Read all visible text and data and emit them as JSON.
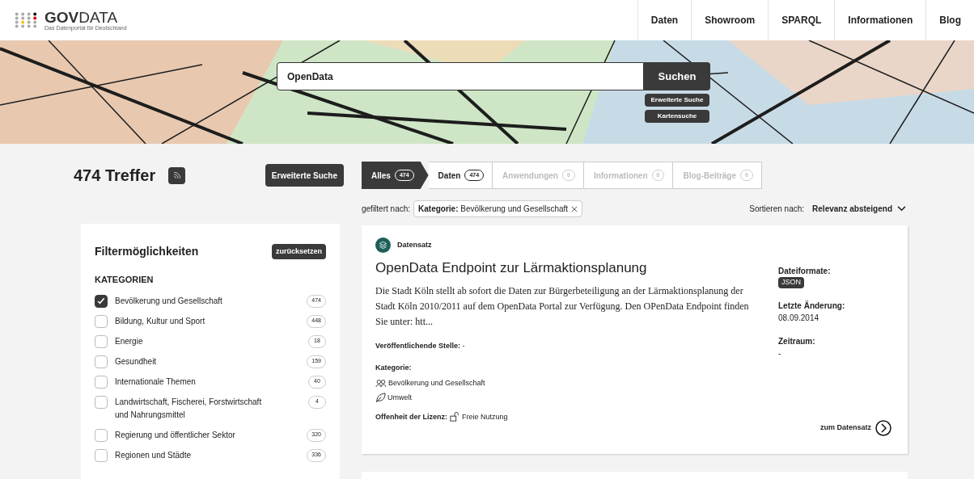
{
  "header": {
    "logo_bold": "GOV",
    "logo_rest": "DATA",
    "tagline": "Das Datenportal für Deutschland",
    "nav": [
      "Daten",
      "Showroom",
      "SPARQL",
      "Informationen",
      "Blog"
    ]
  },
  "hero": {
    "search": {
      "value": "OpenData"
    },
    "search_button": "Suchen",
    "links": [
      "Erweiterte Suche",
      "Kartensuche"
    ]
  },
  "results": {
    "title": "474 Treffer",
    "advanced_button": "Erweiterte Suche"
  },
  "filters": {
    "title": "Filtermöglichkeiten",
    "reset": "zurücksetzen",
    "section": "KATEGORIEN",
    "items": [
      {
        "label": "Bevölkerung und Gesellschaft",
        "count": "474",
        "checked": true
      },
      {
        "label": "Bildung, Kultur und Sport",
        "count": "448",
        "checked": false
      },
      {
        "label": "Energie",
        "count": "18",
        "checked": false
      },
      {
        "label": "Gesundheit",
        "count": "159",
        "checked": false
      },
      {
        "label": "Internationale Themen",
        "count": "40",
        "checked": false
      },
      {
        "label": "Landwirtschaft, Fischerei, Forstwirtschaft und Nahrungsmittel",
        "count": "4",
        "checked": false
      },
      {
        "label": "Regierung und öffentlicher Sektor",
        "count": "320",
        "checked": false
      },
      {
        "label": "Regionen und Städte",
        "count": "336",
        "checked": false
      }
    ]
  },
  "tabs": [
    {
      "label": "Alles",
      "count": "474",
      "selected": true,
      "disabled": false
    },
    {
      "label": "Daten",
      "count": "474",
      "selected": false,
      "disabled": false
    },
    {
      "label": "Anwendungen",
      "count": "0",
      "selected": false,
      "disabled": true
    },
    {
      "label": "Informationen",
      "count": "0",
      "selected": false,
      "disabled": true
    },
    {
      "label": "Blog-Beiträge",
      "count": "0",
      "selected": false,
      "disabled": true
    }
  ],
  "active_filter": {
    "prefix": "gefiltert nach:",
    "chip": "**Kategorie:** Bevölkerung und Gesellschaft"
  },
  "sort": {
    "label": "Sortieren nach:",
    "value": "Relevanz absteigend"
  },
  "card": {
    "type": "Datensatz",
    "title": "OpenData Endpoint zur Lärmaktionsplanung",
    "description": "Die Stadt Köln stellt ab sofort die Daten zur Bürgerbeteiligung an der Lärmaktionsplanung der Stadt Köln 2010/2011 auf dem OpenData Portal zur Verfügung. Den OPenData Endpoint finden Sie unter: htt...",
    "publisher": "**Veröffentlichende Stelle:** -",
    "category_label": "Kategorie:",
    "categories": [
      "Bevölkerung und Gesellschaft",
      "Umwelt"
    ],
    "license_label": "Offenheit der Lizenz:",
    "license": "Freie Nutzung",
    "formats_label": "Dateiformate:",
    "formats": [
      "JSON"
    ],
    "changed_label": "Letzte Änderung:",
    "changed": "08.09.2014",
    "period_label": "Zeitraum:",
    "period": "-",
    "link": "zum Datensatz"
  }
}
